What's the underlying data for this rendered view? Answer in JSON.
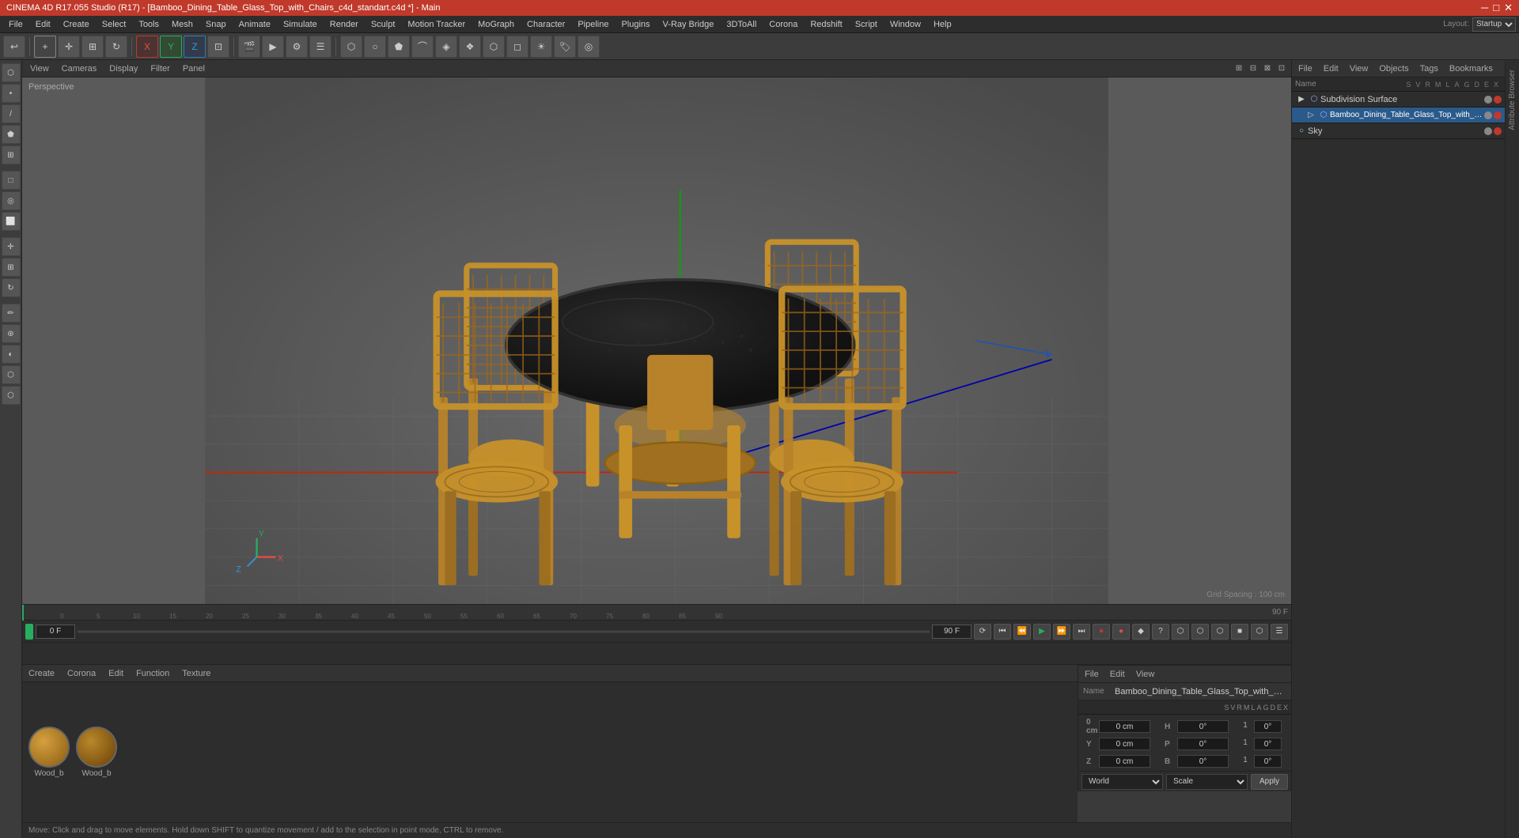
{
  "titleBar": {
    "title": "CINEMA 4D R17.055 Studio (R17) - [Bamboo_Dining_Table_Glass_Top_with_Chairs_c4d_standart.c4d *] - Main",
    "controls": [
      "─",
      "□",
      "✕"
    ]
  },
  "menuBar": {
    "items": [
      "File",
      "Edit",
      "Create",
      "Select",
      "Tools",
      "Mesh",
      "Snap",
      "Animate",
      "Simulate",
      "Render",
      "Sculpt",
      "Motion Tracker",
      "MoGraph",
      "Character",
      "Pipeline",
      "Plugins",
      "V-Ray Bridge",
      "3DToAll",
      "Corona",
      "Redshift",
      "Script",
      "Window",
      "Help"
    ]
  },
  "layout": {
    "label": "Layout:",
    "value": "Startup"
  },
  "viewport": {
    "label": "Perspective",
    "viewMenu": [
      "View",
      "Cameras",
      "Display",
      "Filter",
      "Panel"
    ],
    "gridSpacing": "Grid Spacing : 100 cm"
  },
  "objectManager": {
    "menuItems": [
      "File",
      "Edit",
      "View",
      "Objects",
      "Tags",
      "Bookmarks"
    ],
    "columns": [
      "S",
      "V",
      "R",
      "M",
      "L",
      "A",
      "G",
      "D",
      "E",
      "X"
    ],
    "objects": [
      {
        "name": "Subdivision Surface",
        "indent": 0,
        "icon": "⬜",
        "hasTag": false
      },
      {
        "name": "Bamboo_Dining_Table_Glass_Top_with_Chairs",
        "indent": 1,
        "icon": "⬜",
        "hasTag": true
      },
      {
        "name": "Sky",
        "indent": 0,
        "icon": "○",
        "hasTag": false
      }
    ]
  },
  "timeline": {
    "ticks": [
      0,
      5,
      10,
      15,
      20,
      25,
      30,
      35,
      40,
      45,
      50,
      55,
      60,
      65,
      70,
      75,
      80,
      85,
      90
    ],
    "currentFrame": "0 F",
    "startFrame": "0 F",
    "endFrame": "90 F",
    "playheadPos": "0 F"
  },
  "materialEditor": {
    "menuItems": [
      "Create",
      "Corona",
      "Edit",
      "Function",
      "Texture"
    ],
    "materials": [
      {
        "name": "Wood_b",
        "type": "wood"
      },
      {
        "name": "Wood_b",
        "type": "wood2"
      }
    ]
  },
  "attributes": {
    "menuItems": [
      "File",
      "Edit",
      "View"
    ],
    "objectName": "Bamboo_Dining_Table_Glass_Top_with_Chairs",
    "columnHeaders": [
      "S",
      "V",
      "R",
      "M",
      "L",
      "A",
      "G",
      "D",
      "E",
      "X"
    ],
    "coords": {
      "x": {
        "pos": "0 cm",
        "rot": "0°"
      },
      "y": {
        "pos": "0 cm",
        "rot": "0°"
      },
      "z": {
        "pos": "0 cm",
        "rot": "0°"
      },
      "h": "0°",
      "p": "0°",
      "b": "0°"
    },
    "coordLabels": {
      "x": "X",
      "y": "Y",
      "z": "Z",
      "posLabel": "X",
      "rotLabel": "H",
      "sizeLabel": "B"
    },
    "worldDropdown": "World",
    "scaleDropdown": "Scale",
    "applyButton": "Apply"
  },
  "statusBar": {
    "message": "Move: Click and drag to move elements. Hold down SHIFT to quantize movement / add to the selection in point mode, CTRL to remove."
  }
}
